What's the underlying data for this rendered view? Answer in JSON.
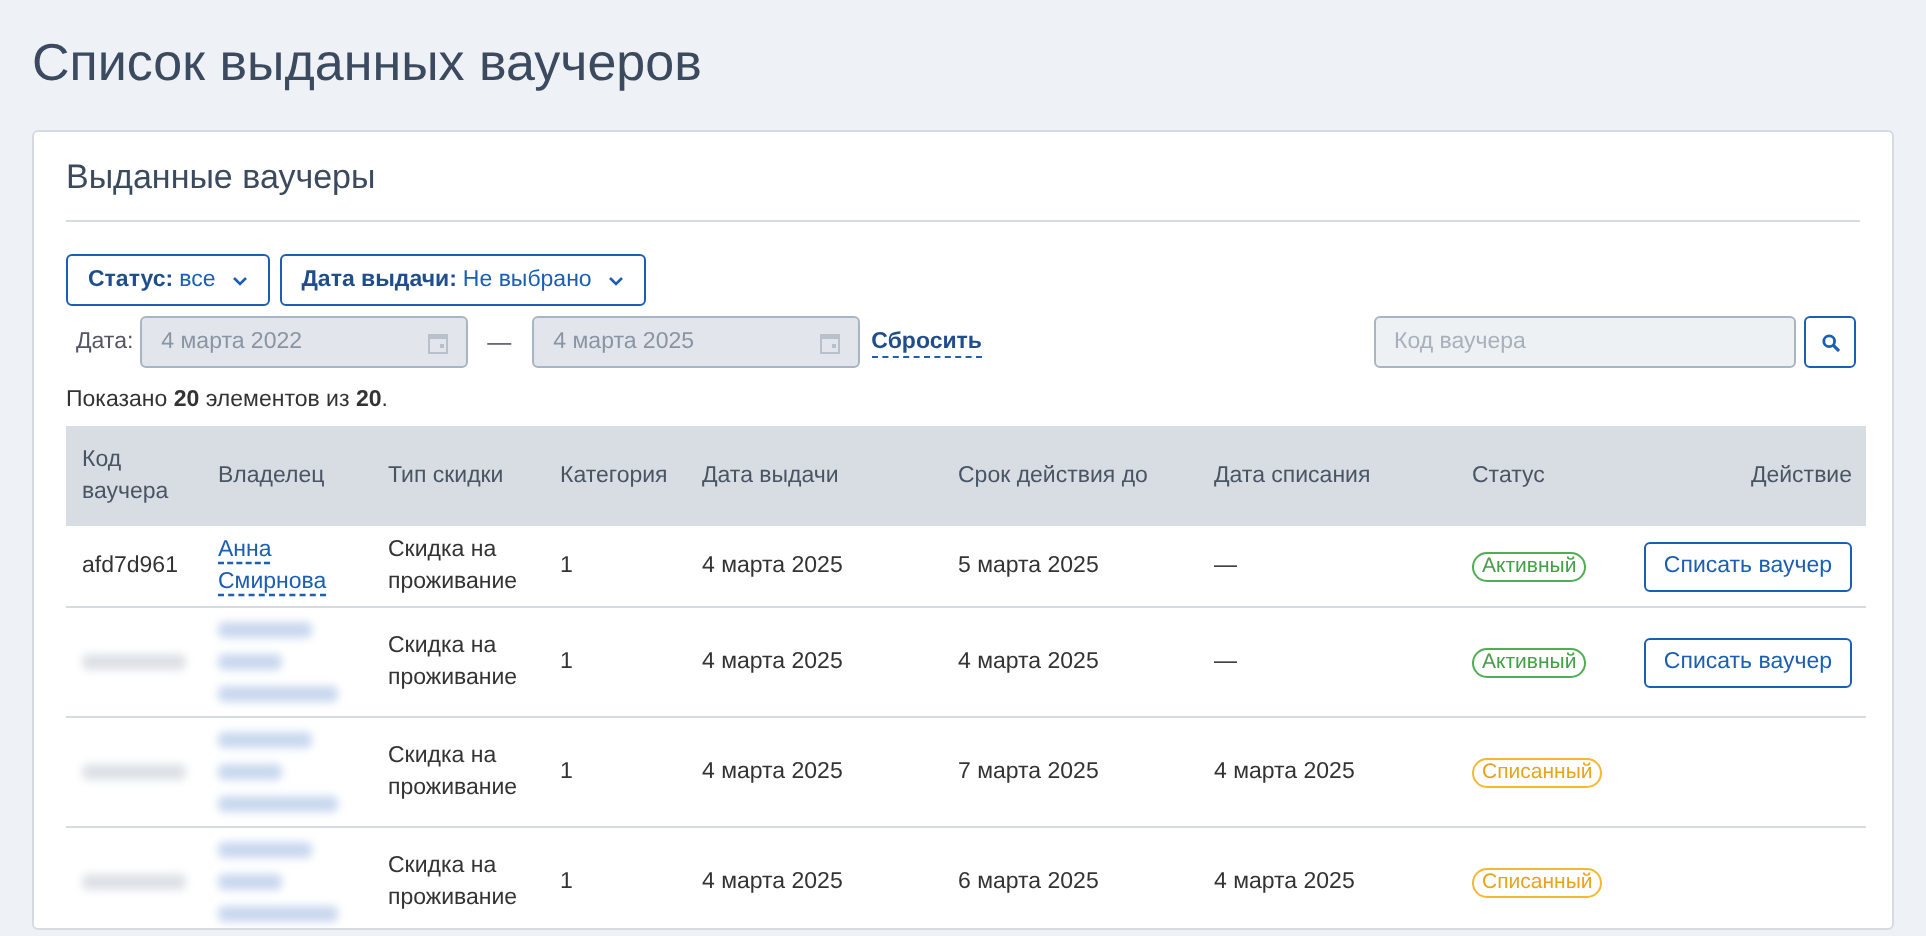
{
  "page_title": "Список выданных ваучеров",
  "card": {
    "title": "Выданные ваучеры",
    "filters": [
      {
        "label": "Статус:",
        "value": "все"
      },
      {
        "label": "Дата выдачи:",
        "value": "Не выбрано"
      }
    ],
    "date_filter": {
      "label": "Дата:",
      "from": "4 марта 2022",
      "to": "4 марта 2025",
      "separator": "—",
      "disabled": true
    },
    "reset": "Сбросить",
    "search": {
      "placeholder": "Код ваучера"
    },
    "summary": "Показано **20** элементов из **20**.",
    "table": {
      "columns": [
        "Код ваучера",
        "Владелец",
        "Тип скидки",
        "Категория",
        "Дата выдачи",
        "Срок действия до",
        "Дата списания",
        "Статус",
        "Действие"
      ],
      "rows": [
        {
          "redacted": false,
          "code": "afd7d961",
          "owner": "Анна Смирнова",
          "discount_type": "Скидка на проживание",
          "category": "1",
          "issued": "4 марта 2025",
          "valid_until": "5 марта 2025",
          "written_off": "—",
          "status": {
            "label": "Активный",
            "kind": "active"
          },
          "action": "Списать ваучер"
        },
        {
          "redacted": true,
          "discount_type": "Скидка на проживание",
          "category": "1",
          "issued": "4 марта 2025",
          "valid_until": "4 марта 2025",
          "written_off": "—",
          "status": {
            "label": "Активный",
            "kind": "active"
          },
          "action": "Списать ваучер"
        },
        {
          "redacted": true,
          "discount_type": "Скидка на проживание",
          "category": "1",
          "issued": "4 марта 2025",
          "valid_until": "7 марта 2025",
          "written_off": "4 марта 2025",
          "status": {
            "label": "Списанный",
            "kind": "written_off"
          }
        },
        {
          "redacted": true,
          "discount_type": "Скидка на проживание",
          "category": "1",
          "issued": "4 марта 2025",
          "valid_until": "6 марта 2025",
          "written_off": "4 марта 2025",
          "status": {
            "label": "Списанный",
            "kind": "written_off"
          }
        }
      ]
    }
  }
}
